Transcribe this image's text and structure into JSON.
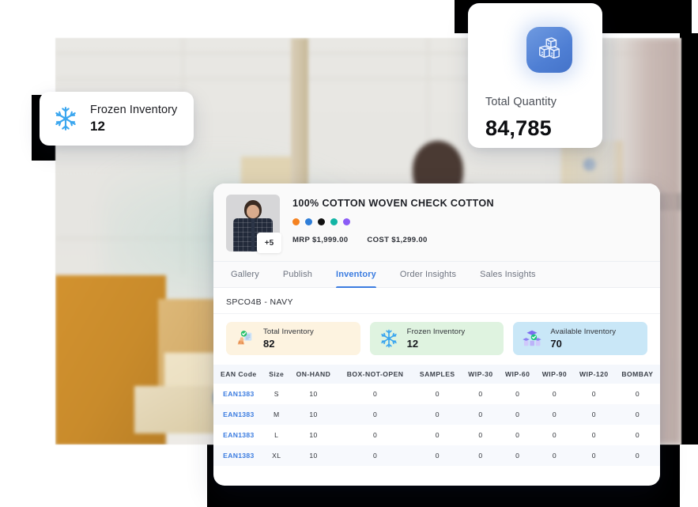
{
  "floating_kpi": {
    "icon": "snowflake-icon",
    "label": "Frozen Inventory",
    "value": "12"
  },
  "total_quantity_card": {
    "icon": "boxes-icon",
    "label": "Total Quantity",
    "value": "84,785",
    "icon_bg": "#4f7fd4"
  },
  "product": {
    "thumbnail_badge": "+5",
    "title": "100% COTTON WOVEN CHECK COTTON",
    "swatches": [
      "#f58220",
      "#2f7ed8",
      "#111111",
      "#12b5a5",
      "#8b5cf6"
    ],
    "mrp": "MRP $1,999.00",
    "cost": "COST $1,299.00"
  },
  "tabs": [
    {
      "label": "Gallery",
      "active": false
    },
    {
      "label": "Publish",
      "active": false
    },
    {
      "label": "Inventory",
      "active": true
    },
    {
      "label": "Order Insights",
      "active": false
    },
    {
      "label": "Sales Insights",
      "active": false
    }
  ],
  "active_tab_color": "#3b7ce0",
  "sku": "SPCO4B - NAVY",
  "inventory_kpis": [
    {
      "icon": "stacked-boxes-check-icon",
      "label": "Total Inventory",
      "value": "82",
      "bg": "#fdf3e0"
    },
    {
      "icon": "snowflake-icon",
      "label": "Frozen Inventory",
      "value": "12",
      "bg": "#dff3e0"
    },
    {
      "icon": "available-boxes-check-icon",
      "label": "Available Inventory",
      "value": "70",
      "bg": "#c9e7f7"
    }
  ],
  "table": {
    "columns": [
      "EAN Code",
      "Size",
      "ON-HAND",
      "BOX-NOT-OPEN",
      "SAMPLES",
      "WIP-30",
      "WIP-60",
      "WIP-90",
      "WIP-120",
      "BOMBAY"
    ],
    "rows": [
      [
        "EAN1383",
        "S",
        "10",
        "0",
        "0",
        "0",
        "0",
        "0",
        "0",
        "0"
      ],
      [
        "EAN1383",
        "M",
        "10",
        "0",
        "0",
        "0",
        "0",
        "0",
        "0",
        "0"
      ],
      [
        "EAN1383",
        "L",
        "10",
        "0",
        "0",
        "0",
        "0",
        "0",
        "0",
        "0"
      ],
      [
        "EAN1383",
        "XL",
        "10",
        "0",
        "0",
        "0",
        "0",
        "0",
        "0",
        "0"
      ]
    ]
  }
}
